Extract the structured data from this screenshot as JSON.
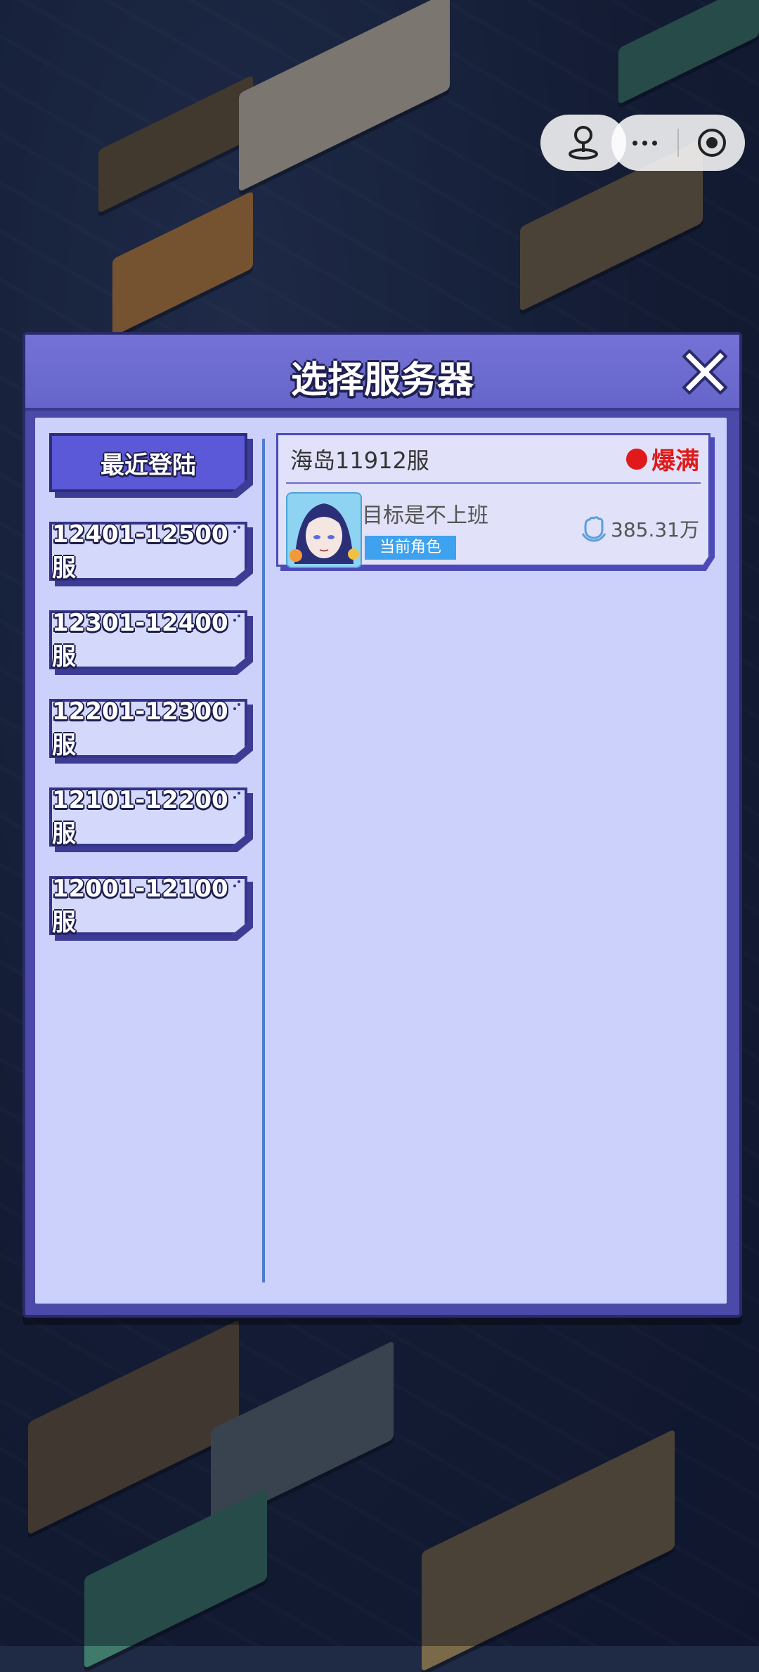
{
  "dialog": {
    "title": "选择服务器"
  },
  "tabs": [
    {
      "label": "最近登陆",
      "active": true
    },
    {
      "label": "12401-12500服",
      "active": false
    },
    {
      "label": "12301-12400服",
      "active": false
    },
    {
      "label": "12201-12300服",
      "active": false
    },
    {
      "label": "12101-12200服",
      "active": false
    },
    {
      "label": "12001-12100服",
      "active": false
    }
  ],
  "server": {
    "name": "海岛11912服",
    "status": "爆满",
    "status_color": "#e01a1a",
    "character_name": "目标是不上班",
    "badge": "当前角色",
    "power": "385.31万"
  },
  "colors": {
    "panel_bg": "#ccd1fb",
    "header_bg": "#6f6ed2",
    "active_tab": "#5b59d8",
    "badge_bg": "#3ea2ee"
  },
  "icons": {
    "capsule_left": "joystick-icon",
    "capsule_more": "more-dots-icon",
    "capsule_close": "target-close-icon",
    "dialog_close": "close-x-icon",
    "power": "fist-icon"
  }
}
